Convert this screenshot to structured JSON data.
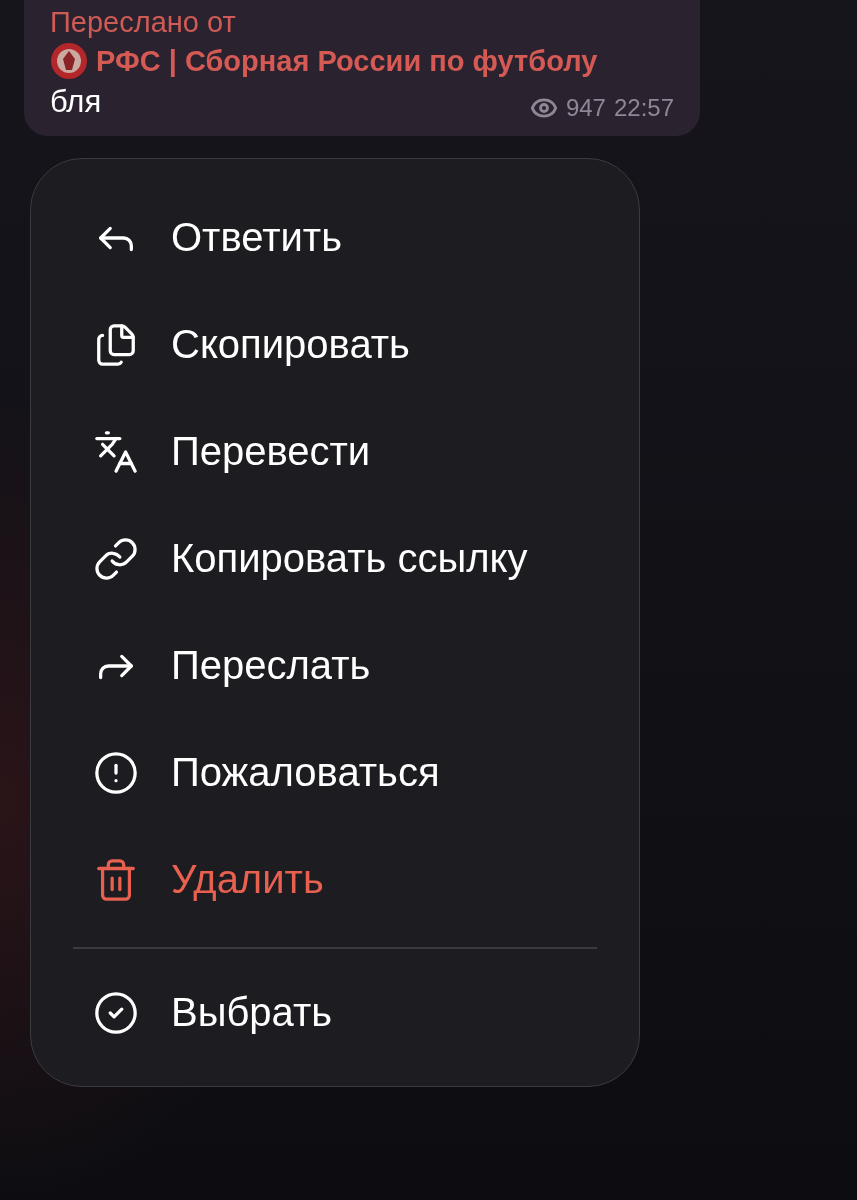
{
  "message": {
    "forwarded_label": "Переслано от",
    "source": "РФС | Сборная России по футболу",
    "text": "бля",
    "views": "947",
    "time": "22:57"
  },
  "menu": {
    "items": [
      {
        "label": "Ответить",
        "kind": "normal"
      },
      {
        "label": "Скопировать",
        "kind": "normal"
      },
      {
        "label": "Перевести",
        "kind": "normal"
      },
      {
        "label": "Копировать ссылку",
        "kind": "normal"
      },
      {
        "label": "Переслать",
        "kind": "normal"
      },
      {
        "label": "Пожаловаться",
        "kind": "normal"
      },
      {
        "label": "Удалить",
        "kind": "danger"
      }
    ],
    "footer_items": [
      {
        "label": "Выбрать",
        "kind": "normal"
      }
    ]
  }
}
